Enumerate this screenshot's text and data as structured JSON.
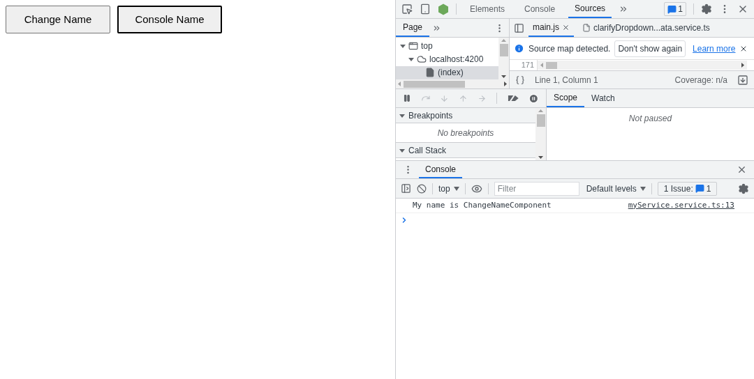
{
  "page": {
    "buttons": [
      {
        "label": "Change Name",
        "focused": false
      },
      {
        "label": "Console Name",
        "focused": true
      }
    ]
  },
  "devtools": {
    "main_tabs": [
      {
        "label": "Elements",
        "selected": false
      },
      {
        "label": "Console",
        "selected": false
      },
      {
        "label": "Sources",
        "selected": true
      }
    ],
    "issues_badge": "1",
    "navigator": {
      "tabs": [
        {
          "label": "Page",
          "selected": true
        }
      ],
      "tree": [
        {
          "label": "top",
          "kind": "frame",
          "expanded": true,
          "children": [
            {
              "label": "localhost:4200",
              "kind": "cloud",
              "expanded": true,
              "children": [
                {
                  "label": "(index)",
                  "kind": "file",
                  "selected": true
                }
              ]
            }
          ]
        }
      ]
    },
    "editor": {
      "tabs": [
        {
          "label": "main.js",
          "selected": true,
          "closable": true
        },
        {
          "label": "clarifyDropdown...ata.service.ts",
          "selected": false,
          "closable": false
        }
      ],
      "infobar": {
        "message": "Source map detected.",
        "button": "Don't show again",
        "link": "Learn more"
      },
      "line_number": "171",
      "status": {
        "position": "Line 1, Column 1",
        "coverage": "Coverage: n/a"
      }
    },
    "debugger": {
      "sections": [
        {
          "title": "Breakpoints",
          "expanded": true,
          "empty_text": "No breakpoints"
        },
        {
          "title": "Call Stack",
          "expanded": true
        }
      ],
      "side_tabs": [
        {
          "label": "Scope",
          "selected": true
        },
        {
          "label": "Watch",
          "selected": false
        }
      ],
      "scope_text": "Not paused"
    },
    "drawer": {
      "tabs": [
        {
          "label": "Console",
          "selected": true
        }
      ],
      "context": "top",
      "filter_placeholder": "Filter",
      "levels": "Default levels",
      "issues": {
        "label": "1 Issue:",
        "count": "1"
      },
      "messages": [
        {
          "text": "My name is ChangeNameComponent",
          "source": "myService.service.ts:13"
        }
      ]
    }
  }
}
